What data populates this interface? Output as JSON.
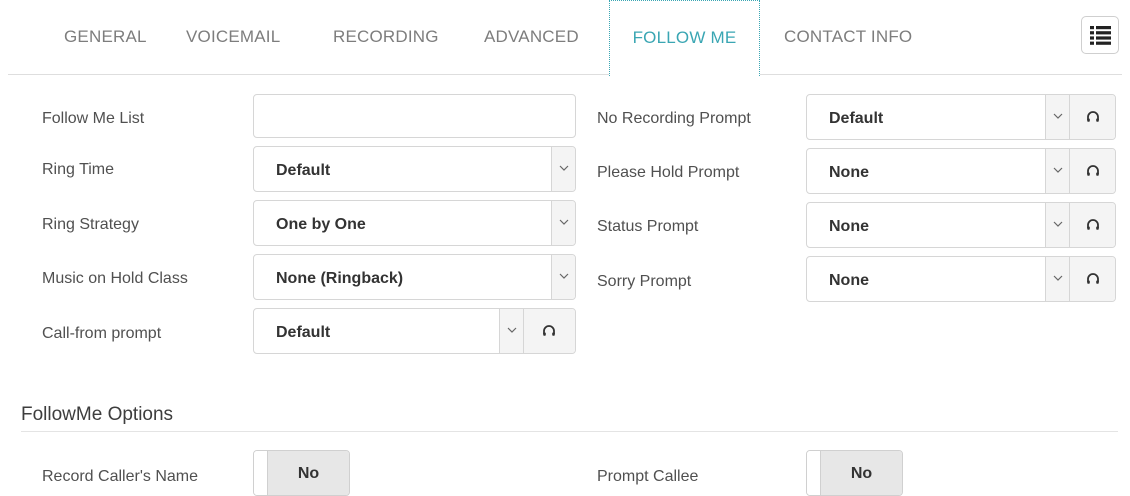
{
  "tabs": [
    {
      "label": "GENERAL"
    },
    {
      "label": "VOICEMAIL"
    },
    {
      "label": "RECORDING"
    },
    {
      "label": "ADVANCED"
    },
    {
      "label": "FOLLOW ME",
      "active": true
    },
    {
      "label": "CONTACT INFO"
    }
  ],
  "left_fields": {
    "follow_me_list": {
      "label": "Follow Me List",
      "value": ""
    },
    "ring_time": {
      "label": "Ring Time",
      "value": "Default"
    },
    "ring_strategy": {
      "label": "Ring Strategy",
      "value": "One by One"
    },
    "music_on_hold": {
      "label": "Music on Hold Class",
      "value": "None (Ringback)"
    },
    "call_from_prompt": {
      "label": "Call-from prompt",
      "value": "Default"
    }
  },
  "right_fields": {
    "no_recording_prompt": {
      "label": "No Recording Prompt",
      "value": "Default"
    },
    "please_hold_prompt": {
      "label": "Please Hold Prompt",
      "value": "None"
    },
    "status_prompt": {
      "label": "Status Prompt",
      "value": "None"
    },
    "sorry_prompt": {
      "label": "Sorry Prompt",
      "value": "None"
    }
  },
  "options": {
    "title": "FollowMe Options",
    "record_callers_name": {
      "label": "Record Caller's Name",
      "value": "No"
    },
    "prompt_callee": {
      "label": "Prompt Callee",
      "value": "No"
    }
  },
  "icons": {
    "menu": "list-icon",
    "chevron": "chevron-down-icon",
    "play": "headphones-icon"
  },
  "colors": {
    "accent": "#3aa6b3",
    "tab_text": "#7d7d7d",
    "label_text": "#505050"
  }
}
